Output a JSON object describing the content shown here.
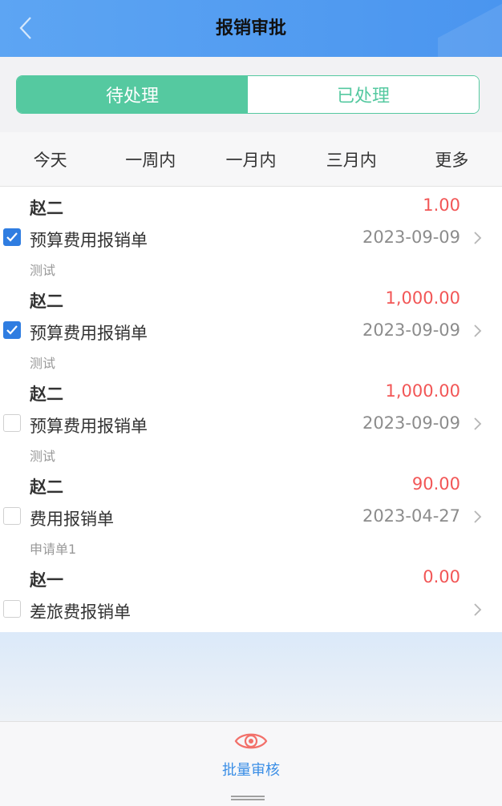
{
  "header": {
    "title": "报销审批"
  },
  "tabs": [
    {
      "label": "待处理",
      "active": true
    },
    {
      "label": "已处理",
      "active": false
    }
  ],
  "filters": [
    "今天",
    "一周内",
    "一月内",
    "三月内",
    "更多"
  ],
  "items": [
    {
      "name": "赵二",
      "amount": "1.00",
      "type": "预算费用报销单",
      "date": "2023-09-09",
      "memo": "测试",
      "checked": true
    },
    {
      "name": "赵二",
      "amount": "1,000.00",
      "type": "预算费用报销单",
      "date": "2023-09-09",
      "memo": "测试",
      "checked": true
    },
    {
      "name": "赵二",
      "amount": "1,000.00",
      "type": "预算费用报销单",
      "date": "2023-09-09",
      "memo": "测试",
      "checked": false
    },
    {
      "name": "赵二",
      "amount": "90.00",
      "type": "费用报销单",
      "date": "2023-04-27",
      "memo": "申请单1",
      "checked": false
    },
    {
      "name": "赵一",
      "amount": "0.00",
      "type": "差旅费报销单",
      "date": "",
      "memo": "",
      "checked": false
    }
  ],
  "bottom": {
    "batch_label": "批量审核"
  },
  "colors": {
    "header": "#5da5f3",
    "accent": "#55c9a0",
    "amount": "#f25656",
    "checkbox": "#2f7de1",
    "batch": "#3a8ee6",
    "eye": "#f2706a"
  },
  "icons": {
    "back": "chevron-left-icon",
    "row": "chevron-right-icon",
    "batch": "eye-icon",
    "check": "checkmark-icon"
  }
}
